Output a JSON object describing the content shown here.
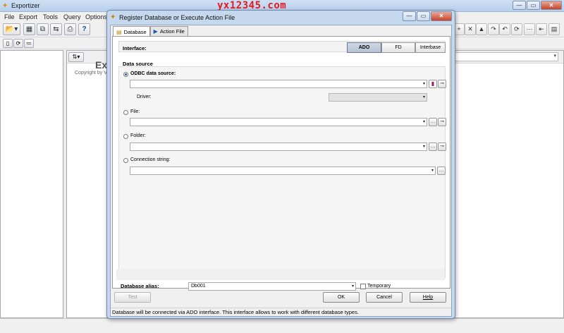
{
  "app": {
    "title": "Exportizer",
    "watermark": "yx12345.com",
    "menu": [
      "File",
      "Export",
      "Tools",
      "Query",
      "Options"
    ],
    "welcome": "Exp",
    "copyright": "Copyright by V"
  },
  "dialog": {
    "title": "Register Database or Execute Action File",
    "tabs": [
      {
        "label": "Database",
        "icon": "database-icon"
      },
      {
        "label": "Action File",
        "icon": "play-icon"
      }
    ],
    "interface": {
      "label": "Interface:",
      "options": [
        "ADO",
        "FD",
        "Interbase"
      ],
      "selected": "ADO"
    },
    "data_source": {
      "label": "Data source",
      "odbc_label": "ODBC data source:",
      "odbc_value": "",
      "driver_label": "Driver:",
      "driver_value": "",
      "file_label": "File:",
      "file_value": "",
      "folder_label": "Folder:",
      "folder_value": "",
      "conn_label": "Connection string:",
      "conn_value": "",
      "selected": "odbc"
    },
    "alias": {
      "label": "Database alias:",
      "value": "Db001",
      "temporary_label": "Temporary",
      "temporary_checked": false
    },
    "buttons": {
      "test": "Test",
      "ok": "OK",
      "cancel": "Cancel",
      "help": "Help"
    },
    "status": "Database will be connected via ADO interface. This interface allows to work with different database types."
  }
}
